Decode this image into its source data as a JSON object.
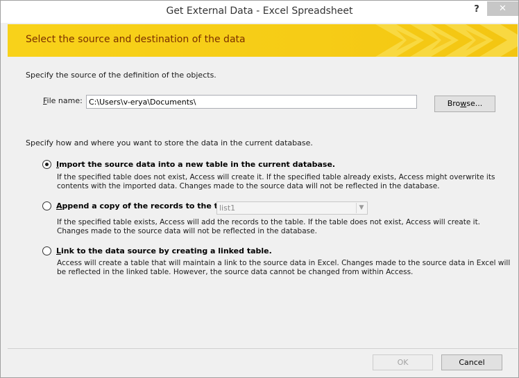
{
  "window": {
    "title": "Get External Data - Excel Spreadsheet",
    "help_label": "?",
    "close_label": "✕"
  },
  "banner": {
    "text": "Select the source and destination of the data"
  },
  "source": {
    "intro": "Specify the source of the definition of the objects.",
    "file_label_accel": "F",
    "file_label_rest": "ile name:",
    "file_value": "C:\\Users\\v-erya\\Documents\\",
    "browse_accel_pre": "Bro",
    "browse_accel": "w",
    "browse_post": "se..."
  },
  "destination": {
    "intro": "Specify how and where you want to store the data in the current database.",
    "options": [
      {
        "accel": "I",
        "label_rest": "mport the source data into a new table in the current database.",
        "selected": true,
        "desc_line1": "If the specified table does not exist, Access will create it. If the specified table already exists, Access might overwrite its",
        "desc_line2": "contents with the imported data. Changes made to the source data will not be reflected in the database."
      },
      {
        "accel": "A",
        "label_rest": "ppend a copy of the records to the table:",
        "selected": false,
        "table_value": "list1",
        "desc_line1": "If the specified table exists, Access will add the records to the table. If the table does not exist, Access will create it.",
        "desc_line2": "Changes made to the source data will not be reflected in the database."
      },
      {
        "accel": "L",
        "label_rest": "ink to the data source by creating a linked table.",
        "selected": false,
        "desc_line1": "Access will create a table that will maintain a link to the source data in Excel. Changes made to the source data in Excel will",
        "desc_line2": "be reflected in the linked table. However, the source data cannot be changed from within Access."
      }
    ]
  },
  "footer": {
    "ok_label": "OK",
    "cancel_label": "Cancel"
  },
  "colors": {
    "banner": "#f8d21a",
    "banner_text": "#7a2f00"
  }
}
